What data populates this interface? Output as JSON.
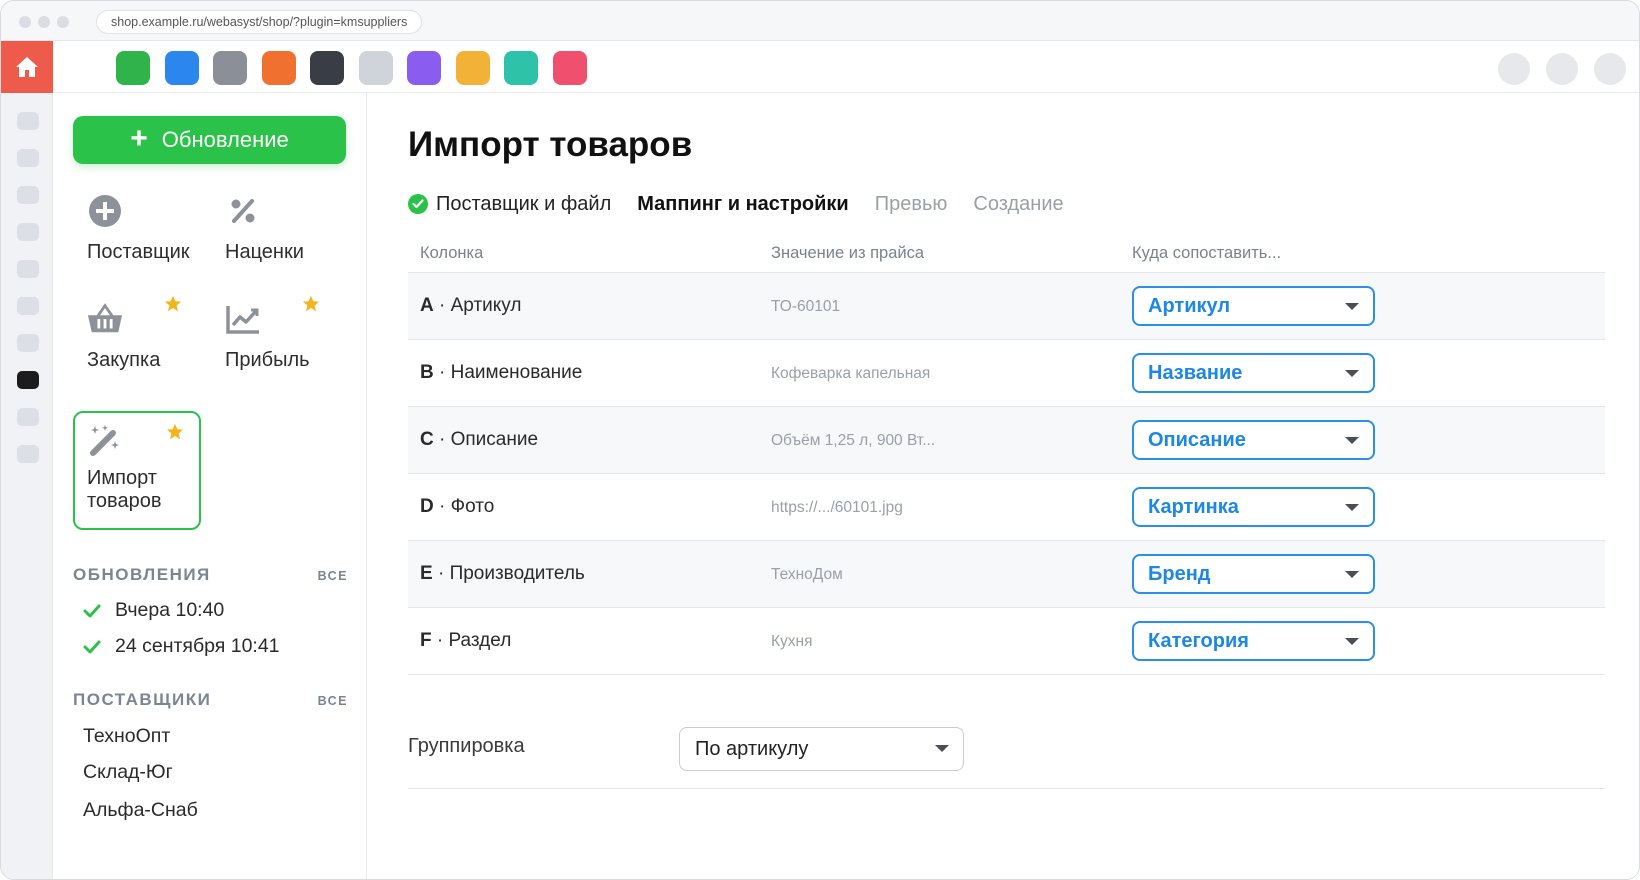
{
  "browser": {
    "url": "shop.example.ru/webasyst/shop/?plugin=kmsuppliers"
  },
  "apps": {
    "colors": [
      "#2fb34a",
      "#2b87ec",
      "#8a8f98",
      "#f0702f",
      "#393d46",
      "#cfd3da",
      "#8b5cf0",
      "#f2b238",
      "#2ec3a8",
      "#f0506e"
    ]
  },
  "sidebar": {
    "update_button": "Обновление",
    "tools": [
      {
        "label": "Поставщик",
        "icon": "add-circle-icon"
      },
      {
        "label": "Наценки",
        "icon": "percent-icon"
      },
      {
        "label": "Закупка",
        "icon": "basket-icon",
        "starred": true
      },
      {
        "label": "Прибыль",
        "icon": "chart-icon",
        "starred": true
      },
      {
        "label": "Импорт товаров",
        "icon": "magic-wand-icon",
        "starred": true,
        "active": true
      }
    ],
    "updates_title": "ОБНОВЛЕНИЯ",
    "updates_all": "ВСЕ",
    "updates": [
      "Вчера 10:40",
      "24 сентября 10:41"
    ],
    "suppliers_title": "ПОСТАВЩИКИ",
    "suppliers_all": "ВСЕ",
    "suppliers": [
      "ТехноОпт",
      "Склад-Юг",
      "Альфа-Снаб"
    ]
  },
  "main": {
    "title": "Импорт товаров",
    "steps": [
      {
        "label": "Поставщик и файл",
        "state": "done"
      },
      {
        "label": "Маппинг и настройки",
        "state": "current"
      },
      {
        "label": "Превью",
        "state": "pending"
      },
      {
        "label": "Создание",
        "state": "pending"
      }
    ],
    "table_headers": {
      "column": "Колонка",
      "value": "Значение из прайса",
      "target": "Куда сопоставить..."
    },
    "rows": [
      {
        "letter": "A",
        "name": " · Артикул",
        "value": "ТО-60101",
        "target": "Артикул"
      },
      {
        "letter": "B",
        "name": " · Наименование",
        "value": "Кофеварка капельная",
        "target": "Название"
      },
      {
        "letter": "C",
        "name": " · Описание",
        "value": "Объём 1,25 л, 900 Вт...",
        "target": "Описание"
      },
      {
        "letter": "D",
        "name": " · Фото",
        "value": "https://.../60101.jpg",
        "target": "Картинка"
      },
      {
        "letter": "E",
        "name": " · Производитель",
        "value": "ТехноДом",
        "target": "Бренд"
      },
      {
        "letter": "F",
        "name": " · Раздел",
        "value": "Кухня",
        "target": "Категория"
      }
    ],
    "grouping": {
      "label": "Группировка",
      "value": "По артикулу"
    }
  }
}
